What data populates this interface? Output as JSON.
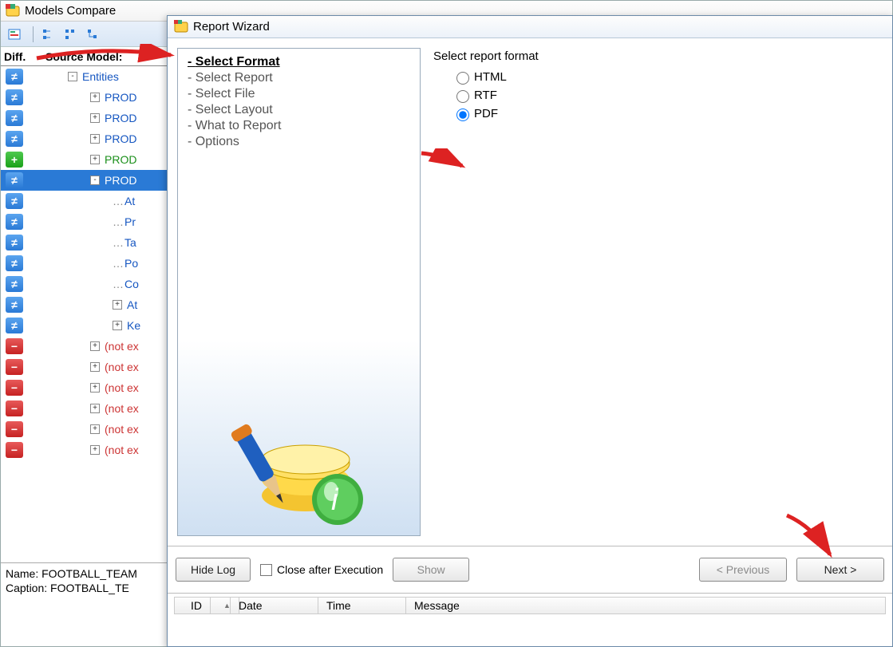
{
  "models_compare": {
    "title": "Models Compare",
    "header": {
      "diff": "Diff.",
      "source": "Source Model:"
    },
    "toolbar_icons": [
      "report-icon",
      "sep",
      "tree1-icon",
      "tree2-icon",
      "tree3-icon"
    ],
    "rows": [
      {
        "badge": "neq",
        "indent": 1,
        "pm": "-",
        "label": "Entities",
        "cls": "link-blue"
      },
      {
        "badge": "neq",
        "indent": 2,
        "pm": "+",
        "label": "PROD",
        "cls": "link-blue"
      },
      {
        "badge": "neq",
        "indent": 2,
        "pm": "+",
        "label": "PROD",
        "cls": "link-blue"
      },
      {
        "badge": "neq",
        "indent": 2,
        "pm": "+",
        "label": "PROD",
        "cls": "link-blue"
      },
      {
        "badge": "plus",
        "indent": 2,
        "pm": "+",
        "label": "PROD",
        "cls": "link-green"
      },
      {
        "badge": "neq",
        "indent": 2,
        "pm": "-",
        "label": "PROD",
        "cls": "link-blue",
        "selected": true
      },
      {
        "badge": "neq",
        "indent": 3,
        "pm": "",
        "label": "At",
        "cls": "link-blue"
      },
      {
        "badge": "neq",
        "indent": 3,
        "pm": "",
        "label": "Pr",
        "cls": "link-blue"
      },
      {
        "badge": "neq",
        "indent": 3,
        "pm": "",
        "label": "Ta",
        "cls": "link-blue"
      },
      {
        "badge": "neq",
        "indent": 3,
        "pm": "",
        "label": "Po",
        "cls": "link-blue"
      },
      {
        "badge": "neq",
        "indent": 3,
        "pm": "",
        "label": "Co",
        "cls": "link-blue"
      },
      {
        "badge": "neq",
        "indent": 3,
        "pm": "+",
        "label": "At",
        "cls": "link-blue"
      },
      {
        "badge": "neq",
        "indent": 3,
        "pm": "+",
        "label": "Ke",
        "cls": "link-blue"
      },
      {
        "badge": "minus",
        "indent": 2,
        "pm": "+",
        "label": "(not ex",
        "cls": "link-red"
      },
      {
        "badge": "minus",
        "indent": 2,
        "pm": "+",
        "label": "(not ex",
        "cls": "link-red"
      },
      {
        "badge": "minus",
        "indent": 2,
        "pm": "+",
        "label": "(not ex",
        "cls": "link-red"
      },
      {
        "badge": "minus",
        "indent": 2,
        "pm": "+",
        "label": "(not ex",
        "cls": "link-red"
      },
      {
        "badge": "minus",
        "indent": 2,
        "pm": "+",
        "label": "(not ex",
        "cls": "link-red"
      },
      {
        "badge": "minus",
        "indent": 2,
        "pm": "+",
        "label": "(not ex",
        "cls": "link-red"
      }
    ],
    "footer_name": "Name: FOOTBALL_TEAM",
    "footer_caption": "Caption: FOOTBALL_TE"
  },
  "report_wizard": {
    "title": "Report Wizard",
    "nav": [
      {
        "label": "Select Format",
        "selected": true
      },
      {
        "label": "Select Report"
      },
      {
        "label": "Select File"
      },
      {
        "label": "Select Layout"
      },
      {
        "label": "What to Report"
      },
      {
        "label": "Options"
      }
    ],
    "group_title": "Select report format",
    "formats": [
      {
        "label": "HTML",
        "checked": false
      },
      {
        "label": "RTF",
        "checked": false
      },
      {
        "label": "PDF",
        "checked": true
      }
    ],
    "buttons": {
      "hide_log": "Hide Log",
      "close_after": "Close after Execution",
      "show": "Show",
      "prev": "< Previous",
      "next": "Next >"
    },
    "log_cols": {
      "id": "ID",
      "date": "Date",
      "time": "Time",
      "msg": "Message"
    }
  }
}
